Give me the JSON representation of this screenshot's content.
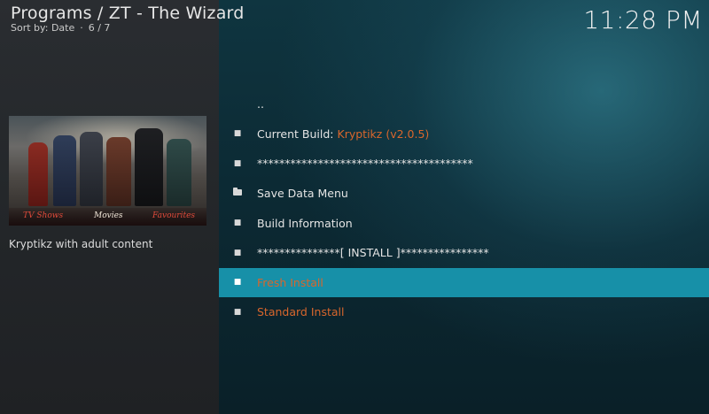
{
  "header": {
    "title": "Programs / ZT - The Wizard",
    "sort_label": "Sort by: Date",
    "position": "6 / 7",
    "separator": "·",
    "clock": "11:28 PM"
  },
  "sidebar": {
    "thumbnail_labels": [
      "TV Shows",
      "Movies",
      "Favourites"
    ],
    "description": "Kryptikz with adult content"
  },
  "list": {
    "items": [
      {
        "icon": "",
        "text": ".."
      },
      {
        "icon": "bullet-icon",
        "text": "Current Build: ",
        "highlight": "Kryptikz (v2.0.5)"
      },
      {
        "icon": "bullet-icon",
        "text": "***************************************"
      },
      {
        "icon": "folder-icon",
        "text": "Save Data Menu"
      },
      {
        "icon": "bullet-icon",
        "text": "Build Information"
      },
      {
        "icon": "bullet-icon",
        "text": "***************[ INSTALL ]****************"
      },
      {
        "icon": "bullet-icon",
        "text": "Fresh Install",
        "selected": true
      },
      {
        "icon": "bullet-icon",
        "text": "Standard Install"
      }
    ]
  },
  "colors": {
    "accent": "#1790a8",
    "highlight_text": "#d9662c"
  }
}
